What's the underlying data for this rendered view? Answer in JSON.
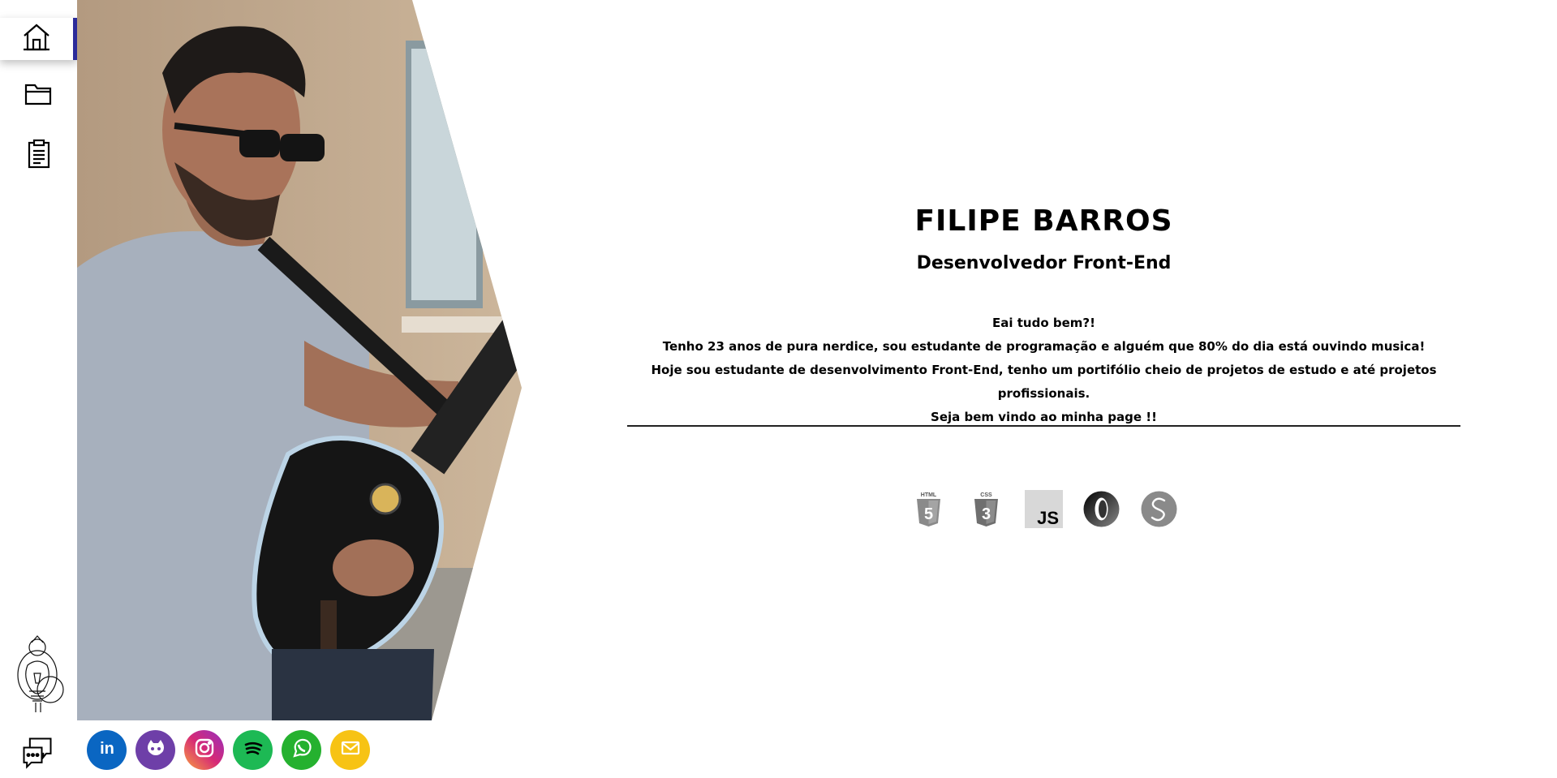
{
  "sidebar": {
    "items": [
      {
        "name": "home",
        "icon": "home-icon",
        "active": true
      },
      {
        "name": "projects",
        "icon": "folder-icon",
        "active": false
      },
      {
        "name": "resume",
        "icon": "clipboard-icon",
        "active": false
      }
    ],
    "logo_icon": "sketch-logo-icon",
    "contact_icon": "chat-bubbles-icon"
  },
  "profile": {
    "name": "FILIPE BARROS",
    "role": "Desenvolvedor Front-End",
    "intro": [
      "Eai tudo bem?!",
      "Tenho 23 anos de pura nerdice, sou estudante de programação e alguém que 80% do dia está ouvindo musica!",
      "Hoje sou estudante de desenvolvimento Front-End, tenho um portifólio cheio de projetos de estudo e até projetos profissionais.",
      "Seja bem vindo ao minha page !!"
    ]
  },
  "tech": [
    {
      "label": "HTML",
      "icon": "html5-icon"
    },
    {
      "label": "CSS",
      "icon": "css3-icon"
    },
    {
      "label": "JS",
      "icon": "javascript-icon"
    },
    {
      "label": "",
      "icon": "json-icon"
    },
    {
      "label": "",
      "icon": "styled-components-icon"
    }
  ],
  "social": [
    {
      "name": "linkedin",
      "label": "in",
      "color": "#0a66c2"
    },
    {
      "name": "github",
      "color": "#6e3fa8"
    },
    {
      "name": "instagram",
      "color": "#c13584"
    },
    {
      "name": "spotify",
      "color": "#1db954"
    },
    {
      "name": "whatsapp",
      "color": "#25b12f"
    },
    {
      "name": "email",
      "color": "#f7c314"
    }
  ],
  "colors": {
    "active_indicator": "#2b2b9a",
    "divider": "#222222"
  }
}
